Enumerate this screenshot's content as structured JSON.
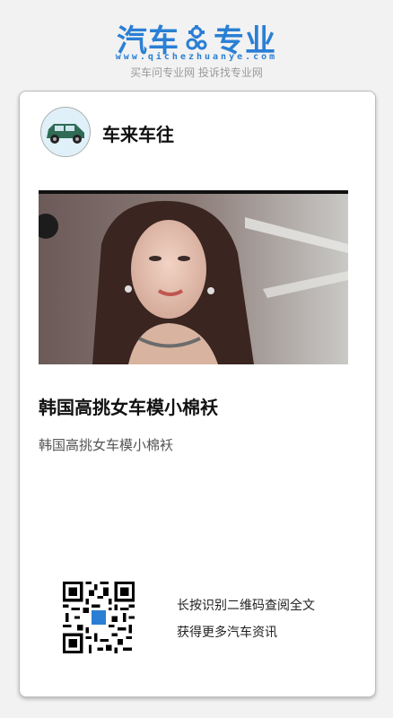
{
  "header": {
    "logo_left": "汽车",
    "logo_right": "专业",
    "logo_url": "www.qichezhuanye.com",
    "tagline": "买车问专业网 投诉找专业网"
  },
  "card": {
    "author_name": "车来车往",
    "article_title": "韩国高挑女车模小棉袄",
    "article_summary": "韩国高挑女车模小棉袄",
    "qr_line1": "长按识别二维码查阅全文",
    "qr_line2": "获得更多汽车资讯"
  },
  "colors": {
    "brand_blue": "#2a7fd4",
    "tagline_gray": "#9a9a9a"
  }
}
